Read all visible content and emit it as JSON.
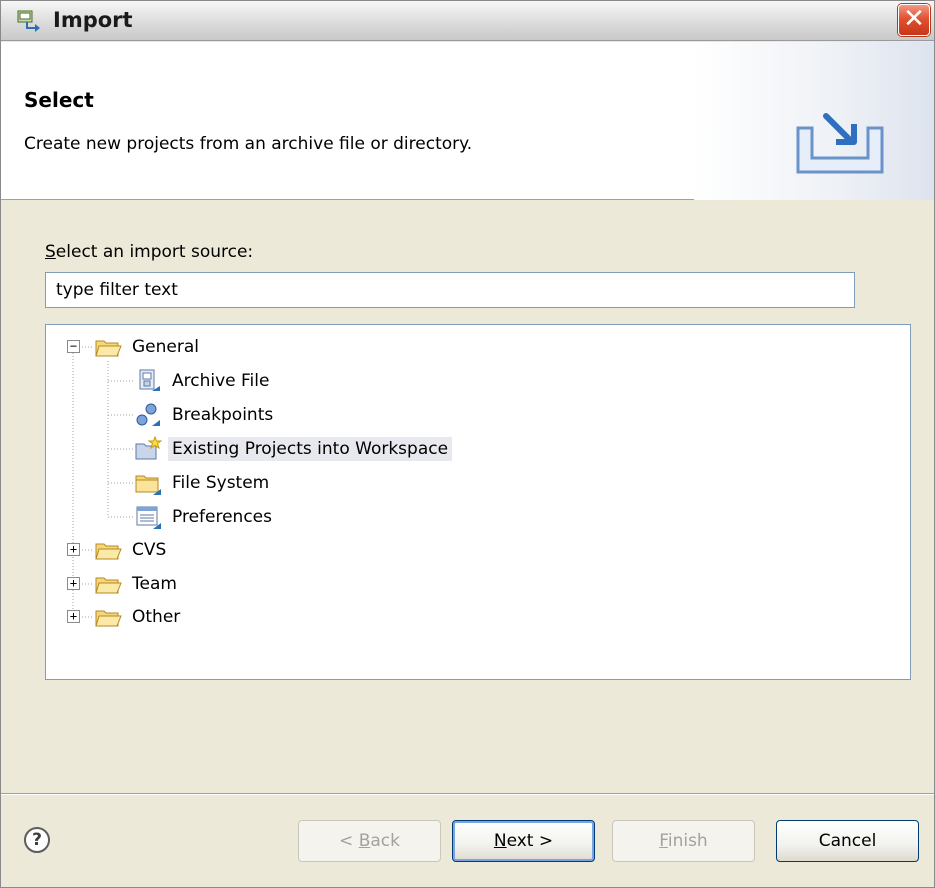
{
  "window": {
    "title": "Import",
    "close_symbol": "✕"
  },
  "banner": {
    "title": "Select",
    "description": "Create new projects from an archive file or directory.",
    "icon": "import-wizard-icon"
  },
  "source": {
    "label_prefix": "S",
    "label_rest": "elect an import source:",
    "filter_value": "type filter text"
  },
  "tree": {
    "items": [
      {
        "label": "General",
        "icon": "folder-open-icon",
        "expander": "−",
        "level": 0
      },
      {
        "label": "Archive File",
        "icon": "archive-file-icon",
        "level": 1
      },
      {
        "label": "Breakpoints",
        "icon": "breakpoints-icon",
        "level": 1
      },
      {
        "label": "Existing Projects into Workspace",
        "icon": "existing-projects-icon",
        "level": 1,
        "selected": true
      },
      {
        "label": "File System",
        "icon": "folder-icon",
        "level": 1
      },
      {
        "label": "Preferences",
        "icon": "preferences-icon",
        "level": 1
      },
      {
        "label": "CVS",
        "icon": "folder-open-icon",
        "expander": "+",
        "level": 0
      },
      {
        "label": "Team",
        "icon": "folder-open-icon",
        "expander": "+",
        "level": 0
      },
      {
        "label": "Other",
        "icon": "folder-open-icon",
        "expander": "+",
        "level": 0
      }
    ]
  },
  "buttons": {
    "help": "?",
    "back_prefix": "< ",
    "back_mnemonic": "B",
    "back_rest": "ack",
    "next_mnemonic": "N",
    "next_rest": "ext >",
    "finish_mnemonic": "F",
    "finish_rest": "inish",
    "cancel": "Cancel"
  },
  "colors": {
    "accent": "#7aa3e2",
    "close": "#e2512f",
    "selection": "#e8e8ef"
  }
}
